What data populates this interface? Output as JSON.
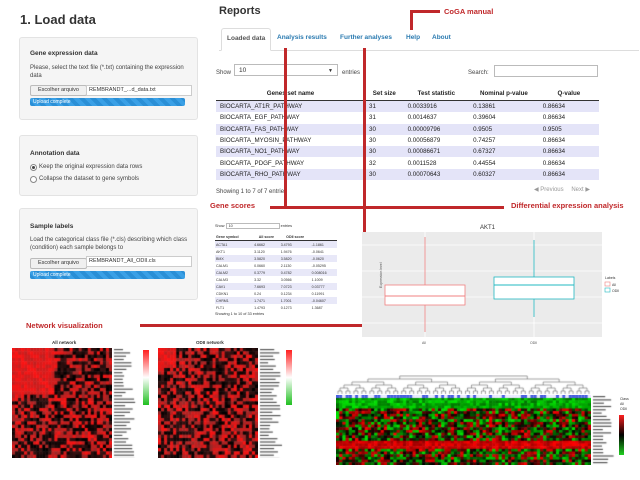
{
  "left": {
    "title": "1. Load data",
    "gene_expression": {
      "heading": "Gene expression data",
      "desc": "Please, select the text file (*.txt) containing the expression data",
      "button": "Escolher arquivo",
      "filename": "REMBRANDT_...d_data.txt",
      "progress": "Upload complete"
    },
    "annotation": {
      "heading": "Annotation data",
      "option1": "Keep the original expression data rows",
      "option2": "Collapse the dataset to gene symbols",
      "selected": "option1"
    },
    "sample_labels": {
      "heading": "Sample labels",
      "desc": "Load the categorical class file (*.cls) describing which class (condition) each sample belongs to",
      "button": "Escolher arquivo",
      "filename": "REMBRANDT_All_ODII.cls",
      "progress": "Upload complete"
    }
  },
  "reports": {
    "title": "Reports",
    "tabs": [
      "Loaded data",
      "Analysis results",
      "Further analyses",
      "Help",
      "About"
    ],
    "active_tab": "Loaded data",
    "show_label": "Show",
    "show_value": "10",
    "entries_label": "entries",
    "search_label": "Search:",
    "columns": [
      "Genes set name",
      "Set size",
      "Test statistic",
      "Nominal p-value",
      "Q-value"
    ],
    "rows": [
      [
        "BIOCARTA_AT1R_PATHWAY",
        "31",
        "0.0033916",
        "0.13861",
        "0.86634"
      ],
      [
        "BIOCARTA_EGF_PATHWAY",
        "31",
        "0.0014637",
        "0.39604",
        "0.86634"
      ],
      [
        "BIOCARTA_FAS_PATHWAY",
        "30",
        "0.00009796",
        "0.9505",
        "0.9505"
      ],
      [
        "BIOCARTA_MYOSIN_PATHWAY",
        "30",
        "0.00056879",
        "0.74257",
        "0.86634"
      ],
      [
        "BIOCARTA_NO1_PATHWAY",
        "30",
        "0.00086671",
        "0.67327",
        "0.86634"
      ],
      [
        "BIOCARTA_PDGF_PATHWAY",
        "32",
        "0.0011528",
        "0.44554",
        "0.86634"
      ],
      [
        "BIOCARTA_RHO_PATHWAY",
        "30",
        "0.00070643",
        "0.60327",
        "0.86634"
      ]
    ],
    "footer": "Showing 1 to 7 of 7 entries",
    "prev": "Previous",
    "next": "Next"
  },
  "annotations": {
    "coga_manual": "CoGA manual",
    "gene_scores": "Gene scores",
    "differential": "Differential expression analysis",
    "network": "Network visualization"
  },
  "gene_scores_mini": {
    "show": "Show",
    "show_value": "10",
    "entries": "entries",
    "columns": [
      "Gene symbol",
      "All score",
      "ODII score"
    ],
    "rows": [
      [
        "ACTA1",
        "4.6662",
        "3.4793",
        "-1.1861"
      ],
      [
        "AKT1",
        "3.1120",
        "1.9476",
        "-0.0641"
      ],
      [
        "BMX",
        "3.5820",
        "3.5820",
        "-0.0620"
      ],
      [
        "CALM1",
        "0.0660",
        "2.1130",
        "-0.05295"
      ],
      [
        "CALM2",
        "0.3779",
        "0.4782",
        "0.008016"
      ],
      [
        "CALM3",
        "3.32",
        "3.0566",
        "1.1009"
      ],
      [
        "CAV1",
        "7.6693",
        "7.0723",
        "0.03777"
      ],
      [
        "CDKN1",
        "0.24",
        "0.1234",
        "0.11991"
      ],
      [
        "CHRM1",
        "1.7471",
        "1.7001",
        "-0.04607"
      ],
      [
        "FLT1",
        "1.4793",
        "0.1273",
        "1.3687"
      ]
    ],
    "footer": "Showing 1 to 10 of 33 entries"
  },
  "boxplot": {
    "title": "AKT1",
    "ylabel": "Expression level",
    "xlabels": [
      "All",
      "ODII"
    ],
    "legend_title": "Labels",
    "legend": [
      "All",
      "ODII"
    ],
    "colors": [
      "#f08080",
      "#20b8c0"
    ]
  },
  "heatmaps": {
    "left_title": "All network",
    "right_title": "ODII network"
  },
  "legend_cluster": {
    "items": [
      "Class",
      "All",
      "ODII"
    ]
  },
  "colors": {
    "accent": "#c0282a",
    "link": "#2a7ab0",
    "progress": "#2a8fd6",
    "row_highlight": "#e4e4f8"
  }
}
